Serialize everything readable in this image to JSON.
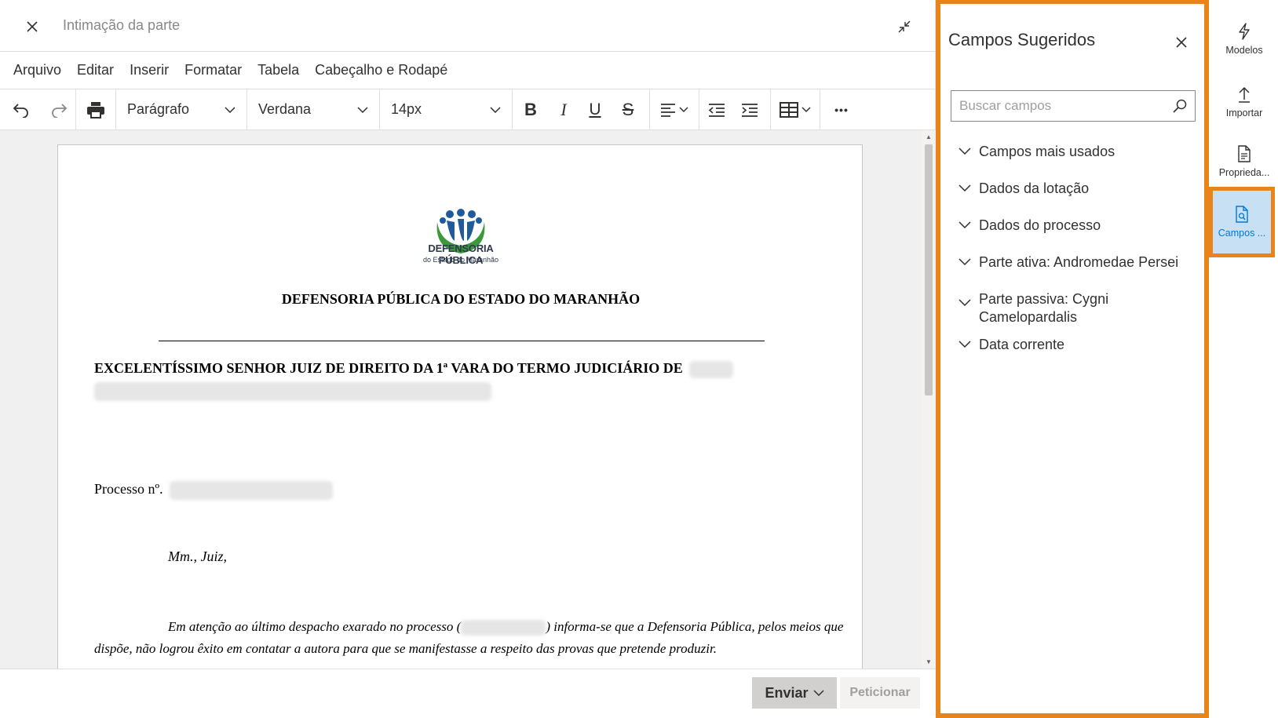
{
  "window": {
    "title": "Intimação da parte"
  },
  "menu": {
    "items": [
      "Arquivo",
      "Editar",
      "Inserir",
      "Formatar",
      "Tabela",
      "Cabeçalho e Rodapé"
    ]
  },
  "toolbar": {
    "paragraph_style": "Parágrafo",
    "font_family": "Verdana",
    "font_size": "14px",
    "bold_label": "B",
    "italic_label": "I",
    "underline_label": "U",
    "strike_label": "S",
    "more_label": "•••"
  },
  "document": {
    "logo_name": "DEFENSORIA PÚBLICA",
    "logo_sub": "do Estado do Maranhão",
    "heading": "DEFENSORIA PÚBLICA DO ESTADO DO MARANHÃO",
    "address": "EXCELENTÍSSIMO SENHOR JUIZ DE DIREITO DA 1ª VARA DO TERMO JUDICIÁRIO DE",
    "processo_label": "Processo nº.",
    "greeting": "Mm., Juiz,",
    "body_part1": "Em atenção ao último despacho exarado no processo (",
    "body_part2": ") informa-se que a Defensoria Pública, pelos meios que dispõe, não logrou êxito em contatar a autora para que se manifestasse a respeito das provas que pretende produzir."
  },
  "footer": {
    "send_label": "Enviar",
    "petition_label": "Peticionar"
  },
  "panel": {
    "title": "Campos Sugeridos",
    "search_placeholder": "Buscar campos",
    "items": [
      "Campos mais usados",
      "Dados da lotação",
      "Dados do processo",
      "Parte ativa: Andromedae Persei",
      "Parte passiva: Cygni Camelopardalis",
      "Data corrente"
    ]
  },
  "rail": {
    "modelos": "Modelos",
    "importar": "Importar",
    "propriedades": "Proprieda...",
    "campos": "Campos ..."
  },
  "colors": {
    "highlight_border": "#e8841a",
    "active_rail_bg": "#c7e0f4",
    "accent": "#0078d4",
    "logo_green": "#3a9a3a",
    "logo_blue": "#1f5a9a"
  }
}
